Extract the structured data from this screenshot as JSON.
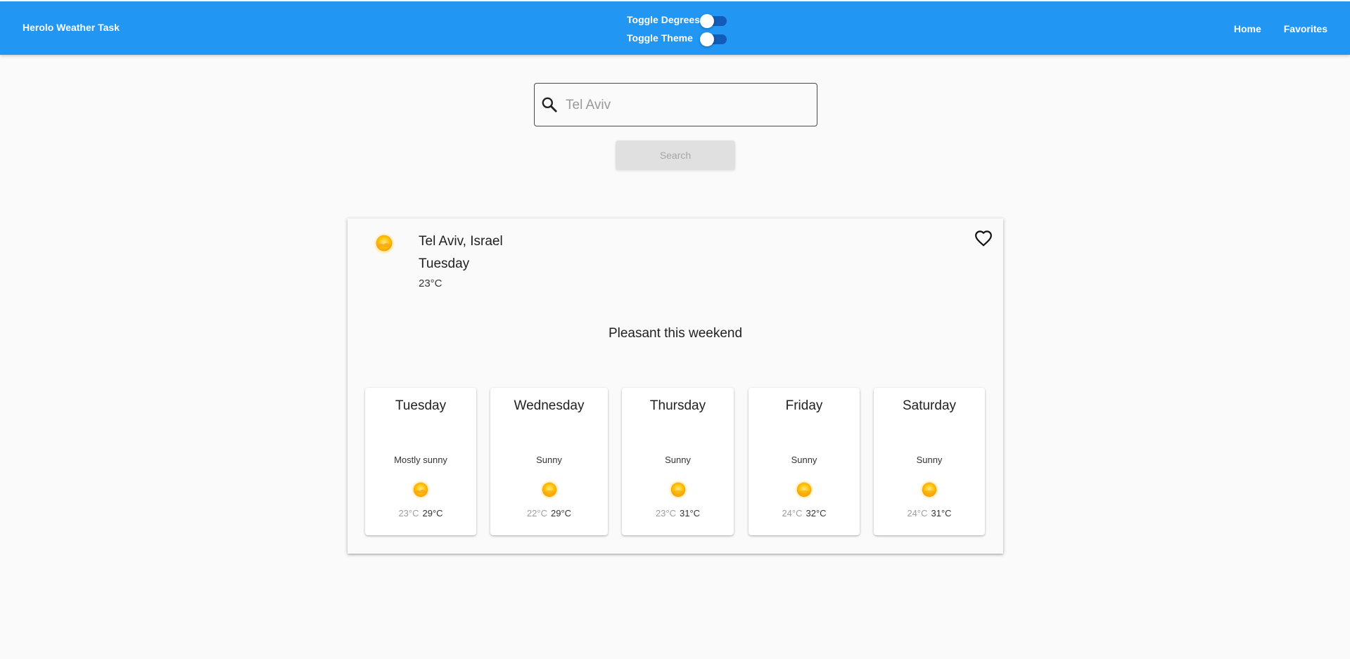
{
  "appbar": {
    "brand": "Herolo Weather Task",
    "toggle_degrees_label": "Toggle Degrees",
    "toggle_theme_label": "Toggle Theme",
    "nav_home": "Home",
    "nav_favorites": "Favorites",
    "color": "#2196f3"
  },
  "search": {
    "value": "",
    "placeholder": "Tel Aviv",
    "button_label": "Search"
  },
  "current": {
    "city": "Tel Aviv, Israel",
    "day": "Tuesday",
    "temp": "23°C",
    "icon": "mostly-sunny-icon"
  },
  "headline": "Pleasant this weekend",
  "forecast": [
    {
      "day": "Tuesday",
      "condition": "Mostly sunny",
      "min": "23°C",
      "max": "29°C",
      "icon": "mostly-sunny-icon"
    },
    {
      "day": "Wednesday",
      "condition": "Sunny",
      "min": "22°C",
      "max": "29°C",
      "icon": "sunny-icon"
    },
    {
      "day": "Thursday",
      "condition": "Sunny",
      "min": "23°C",
      "max": "31°C",
      "icon": "sunny-icon"
    },
    {
      "day": "Friday",
      "condition": "Sunny",
      "min": "24°C",
      "max": "32°C",
      "icon": "sunny-icon"
    },
    {
      "day": "Saturday",
      "condition": "Sunny",
      "min": "24°C",
      "max": "31°C",
      "icon": "sunny-icon"
    }
  ]
}
